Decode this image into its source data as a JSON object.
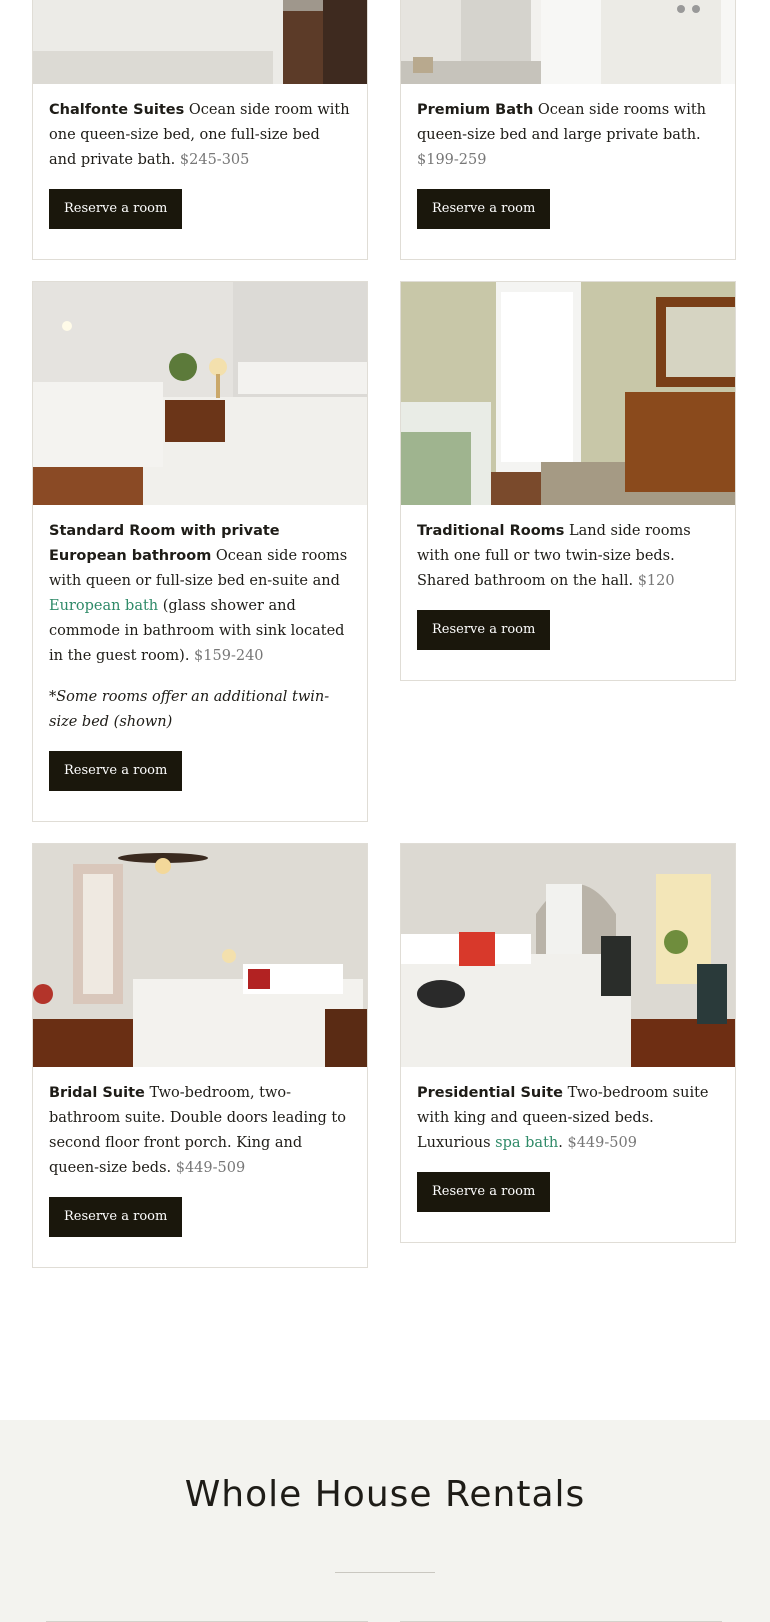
{
  "rooms": [
    {
      "name": "Chalfonte Suites",
      "desc": "Ocean side room with one queen-size bed, one full-size bed and private bath.",
      "price": "$245-305",
      "button": "Reserve a room"
    },
    {
      "name": "Premium Bath",
      "desc": "Ocean side rooms with queen-size bed and large private bath.",
      "price": "$199-259",
      "button": "Reserve a room"
    },
    {
      "name": "Standard Room with private European bathroom",
      "desc_before": "Ocean side rooms with queen or full-size bed en-suite and",
      "link": "European bath",
      "desc_after": "(glass shower and commode in bathroom with sink located in the guest room).",
      "price": "$159-240",
      "note": "*Some rooms offer an additional twin-size bed (shown)",
      "button": "Reserve a room"
    },
    {
      "name": "Traditional Rooms",
      "desc": "Land side rooms with one full or two twin-size beds. Shared bathroom on the hall.",
      "price": "$120",
      "button": "Reserve a room"
    },
    {
      "name": "Bridal Suite",
      "desc": "Two-bedroom, two-bathroom suite. Double doors leading to second floor front porch. King and queen-size beds.",
      "price": "$449-509",
      "button": "Reserve a room"
    },
    {
      "name": "Presidential Suite",
      "desc": "Two-bedroom suite with king and queen-sized beds. Luxurious",
      "link": "spa bath",
      "desc_after": ".",
      "price": "$449-509",
      "button": "Reserve a room"
    }
  ],
  "rentals": {
    "title": "Whole House Rentals"
  },
  "colors": {
    "accent_link": "#2f8a68",
    "button_bg": "#1a170c",
    "section_bg": "#f3f3ef"
  }
}
